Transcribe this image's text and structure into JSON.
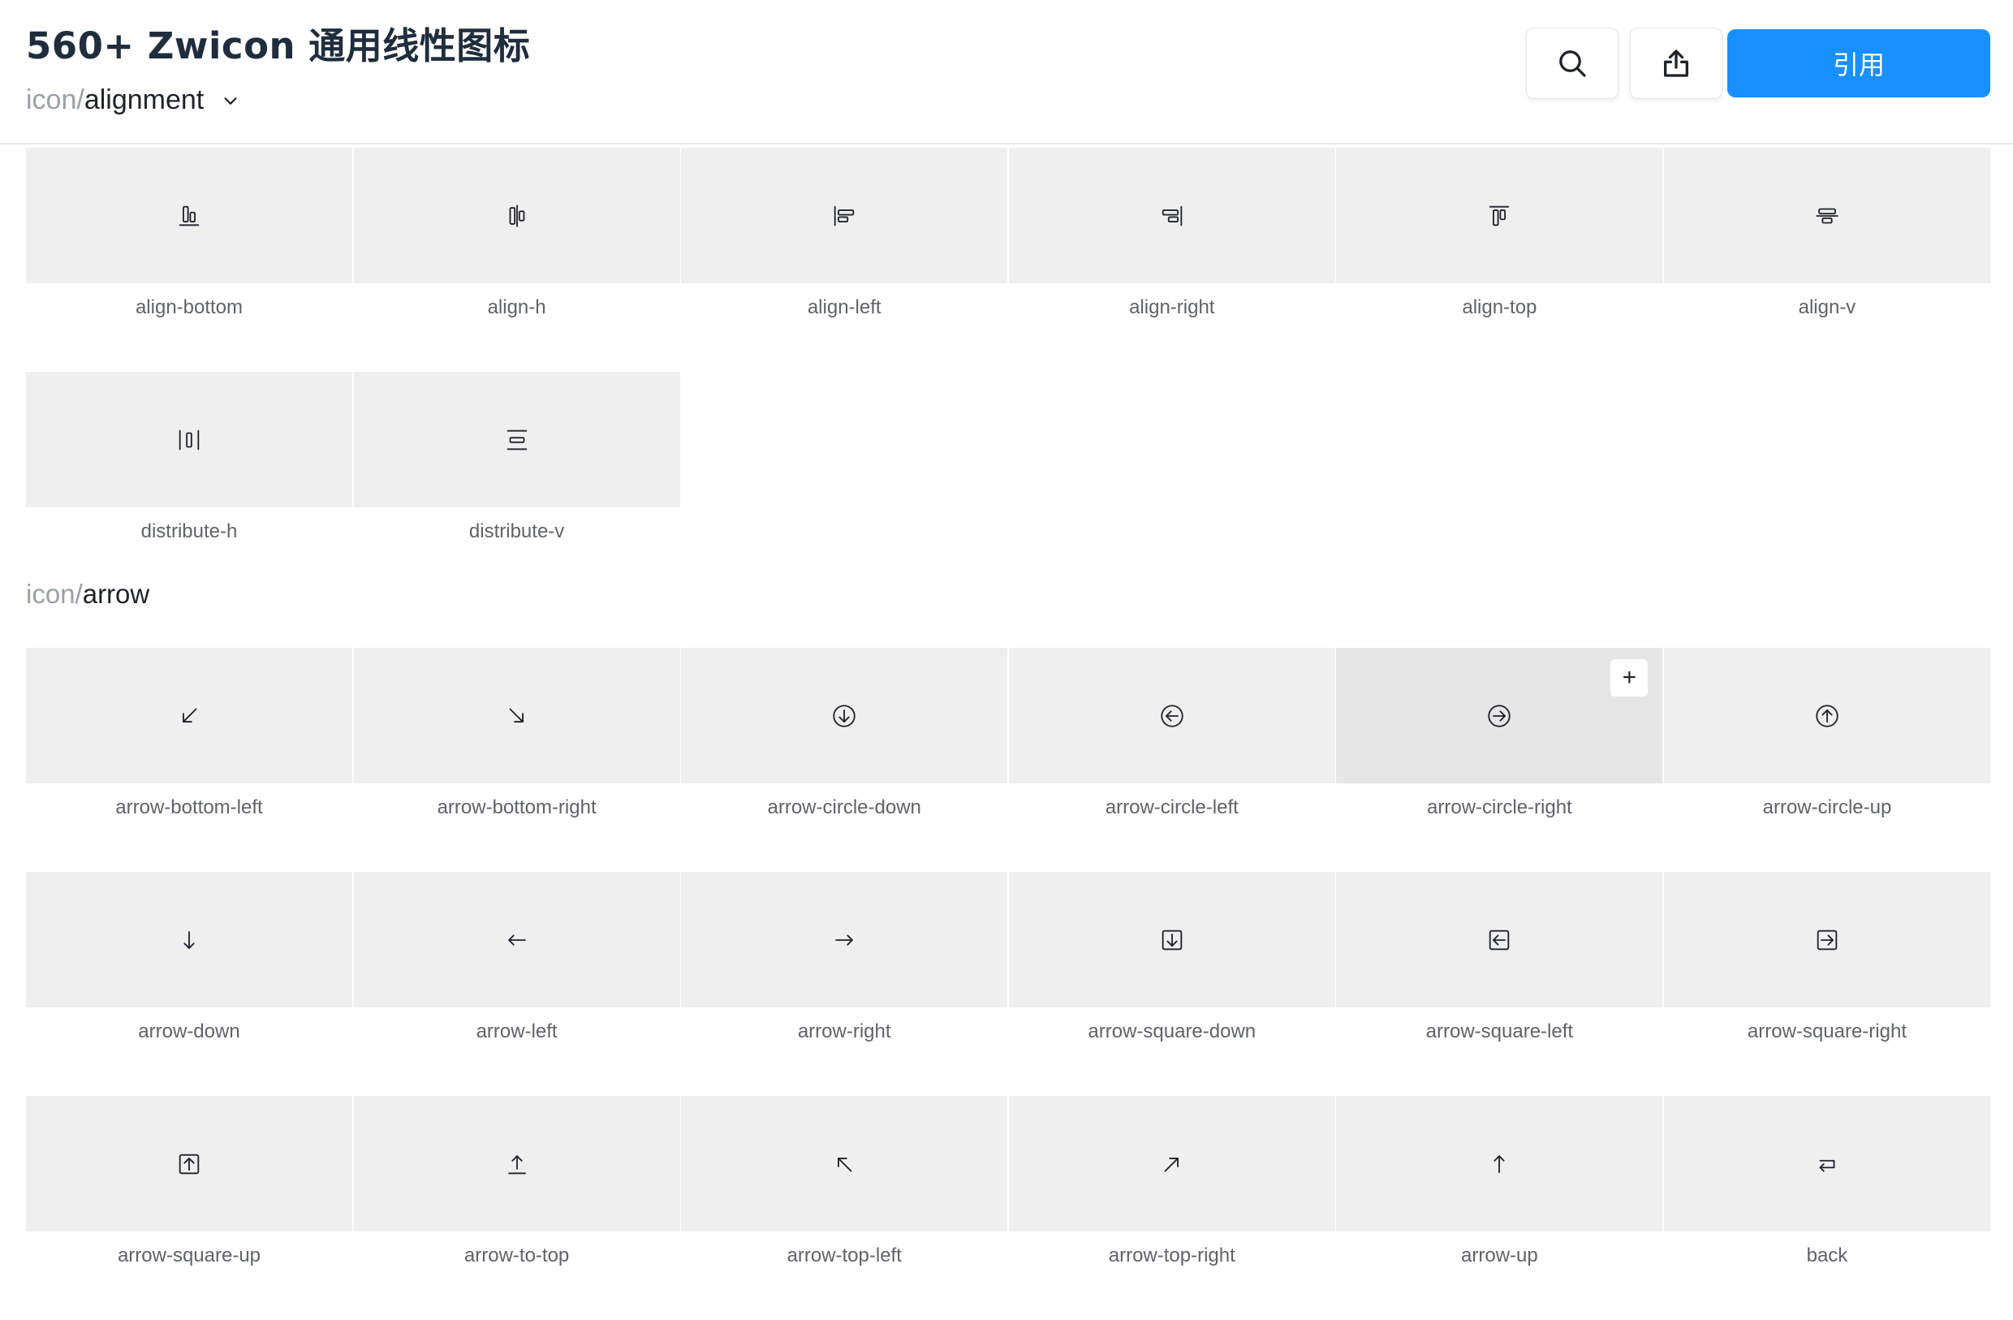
{
  "header": {
    "title": "560+ Zwicon 通用线性图标",
    "breadcrumb_prefix": "icon/",
    "breadcrumb_current": "alignment",
    "cite_label": "引用",
    "accent_color": "#1890ff"
  },
  "sections": [
    {
      "prefix": "icon/",
      "name": "alignment",
      "icons": [
        {
          "label": "align-bottom",
          "icon": "align-bottom-icon"
        },
        {
          "label": "align-h",
          "icon": "align-h-icon"
        },
        {
          "label": "align-left",
          "icon": "align-left-icon"
        },
        {
          "label": "align-right",
          "icon": "align-right-icon"
        },
        {
          "label": "align-top",
          "icon": "align-top-icon"
        },
        {
          "label": "align-v",
          "icon": "align-v-icon"
        },
        {
          "label": "distribute-h",
          "icon": "distribute-h-icon"
        },
        {
          "label": "distribute-v",
          "icon": "distribute-v-icon"
        }
      ]
    },
    {
      "prefix": "icon/",
      "name": "arrow",
      "icons": [
        {
          "label": "arrow-bottom-left",
          "icon": "arrow-bottom-left-icon"
        },
        {
          "label": "arrow-bottom-right",
          "icon": "arrow-bottom-right-icon"
        },
        {
          "label": "arrow-circle-down",
          "icon": "arrow-circle-down-icon"
        },
        {
          "label": "arrow-circle-left",
          "icon": "arrow-circle-left-icon"
        },
        {
          "label": "arrow-circle-right",
          "icon": "arrow-circle-right-icon",
          "hovered": true,
          "action": "+"
        },
        {
          "label": "arrow-circle-up",
          "icon": "arrow-circle-up-icon"
        },
        {
          "label": "arrow-down",
          "icon": "arrow-down-icon"
        },
        {
          "label": "arrow-left",
          "icon": "arrow-left-icon"
        },
        {
          "label": "arrow-right",
          "icon": "arrow-right-icon"
        },
        {
          "label": "arrow-square-down",
          "icon": "arrow-square-down-icon"
        },
        {
          "label": "arrow-square-left",
          "icon": "arrow-square-left-icon"
        },
        {
          "label": "arrow-square-right",
          "icon": "arrow-square-right-icon"
        },
        {
          "label": "arrow-square-up",
          "icon": "arrow-square-up-icon"
        },
        {
          "label": "arrow-to-top",
          "icon": "arrow-to-top-icon"
        },
        {
          "label": "arrow-top-left",
          "icon": "arrow-top-left-icon"
        },
        {
          "label": "arrow-top-right",
          "icon": "arrow-top-right-icon"
        },
        {
          "label": "arrow-up",
          "icon": "arrow-up-icon"
        },
        {
          "label": "back",
          "icon": "back-icon"
        }
      ]
    }
  ]
}
